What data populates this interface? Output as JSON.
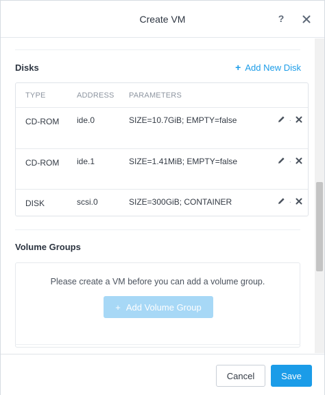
{
  "dialog": {
    "title": "Create VM",
    "help_glyph": "?",
    "close_glyph": "✕"
  },
  "disks": {
    "section_title": "Disks",
    "add_label": "Add New Disk",
    "add_glyph": "+",
    "columns": [
      "TYPE",
      "ADDRESS",
      "PARAMETERS"
    ],
    "rows": [
      {
        "type": "CD-ROM",
        "address": "ide.0",
        "parameters": "SIZE=10.7GiB; EMPTY=false"
      },
      {
        "type": "CD-ROM",
        "address": "ide.1",
        "parameters": "SIZE=1.41MiB; EMPTY=false"
      },
      {
        "type": "DISK",
        "address": "scsi.0",
        "parameters": "SIZE=300GiB; CONTAINER"
      }
    ]
  },
  "volume_groups": {
    "section_title": "Volume Groups",
    "message": "Please create a VM before you can add a volume group.",
    "add_label": "Add Volume Group",
    "add_glyph": "+"
  },
  "footer": {
    "cancel_label": "Cancel",
    "save_label": "Save"
  },
  "colors": {
    "accent": "#1b9ce8",
    "accent_disabled": "#a7d8f6"
  }
}
